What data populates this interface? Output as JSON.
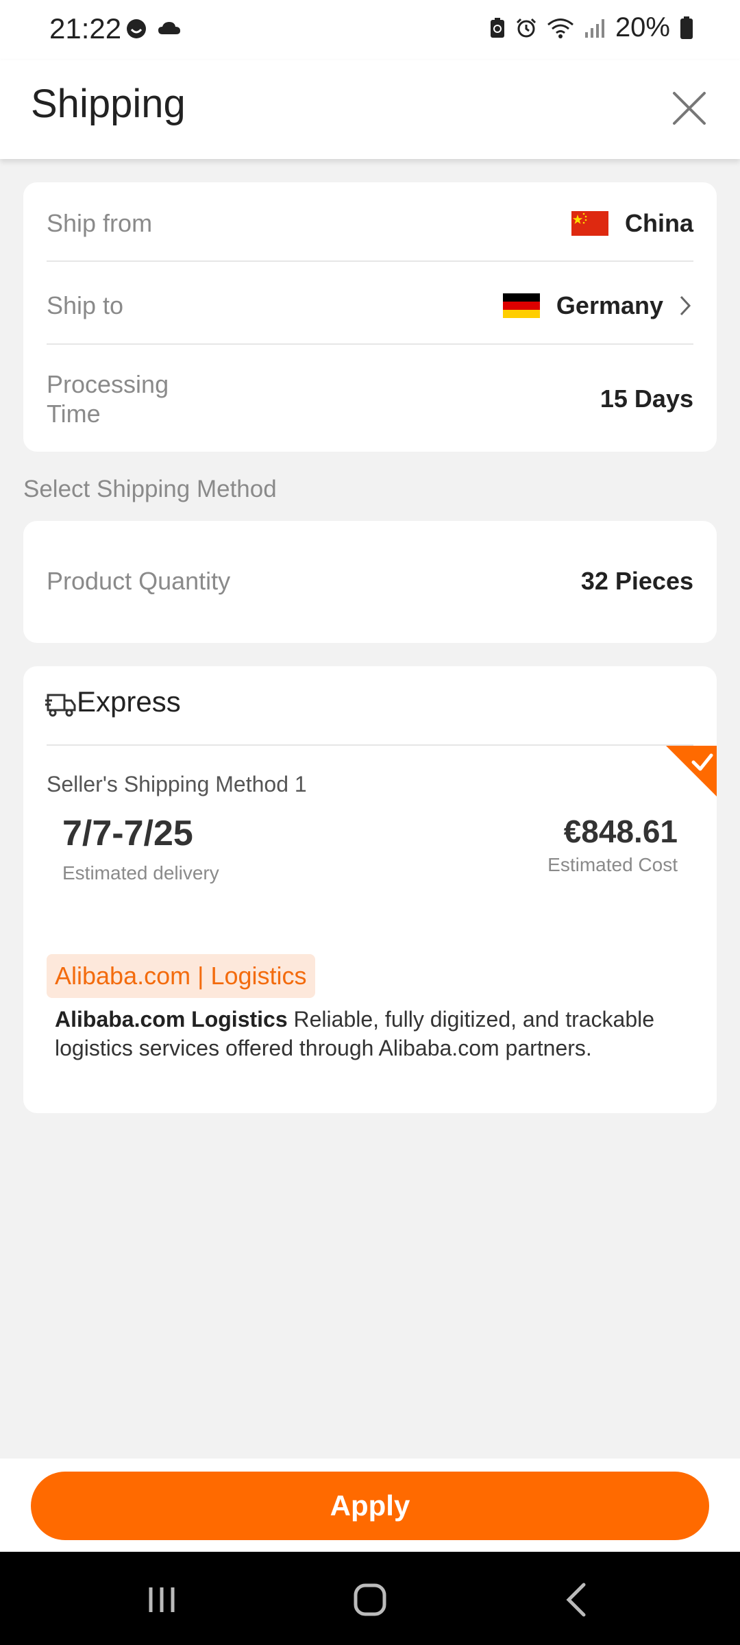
{
  "status_bar": {
    "time": "21:22",
    "battery": "20%",
    "left_icons": [
      "face-icon",
      "cloud-icon"
    ],
    "right_icons": [
      "battery-saver-icon",
      "alarm-icon",
      "wifi-icon",
      "signal-icon",
      "battery-icon"
    ]
  },
  "header": {
    "title": "Shipping",
    "close_icon": "close-icon"
  },
  "shipping_info": {
    "ship_from_label": "Ship from",
    "ship_from_value": "China",
    "ship_to_label": "Ship to",
    "ship_to_value": "Germany",
    "processing_label": "Processing\nTime",
    "processing_value": "15 Days"
  },
  "section": {
    "select_method_label": "Select Shipping Method"
  },
  "quantity": {
    "label": "Product Quantity",
    "value": "32 Pieces"
  },
  "express": {
    "title": "Express",
    "icon": "truck-icon",
    "method_title": "Seller's Shipping Method 1",
    "date_range": "7/7-7/25",
    "estimated_delivery_label": "Estimated delivery",
    "price": "€848.61",
    "estimated_cost_label": "Estimated Cost",
    "selected": true,
    "logistics_badge": "Alibaba.com | Logistics",
    "logistics_desc_bold": "Alibaba.com Logistics",
    "logistics_desc": " Reliable, fully digitized, and trackable logistics services offered through Alibaba.com partners."
  },
  "footer": {
    "apply_label": "Apply"
  },
  "colors": {
    "accent": "#ff6a00",
    "badge_bg": "#fde8db",
    "badge_text": "#f36b0d"
  }
}
